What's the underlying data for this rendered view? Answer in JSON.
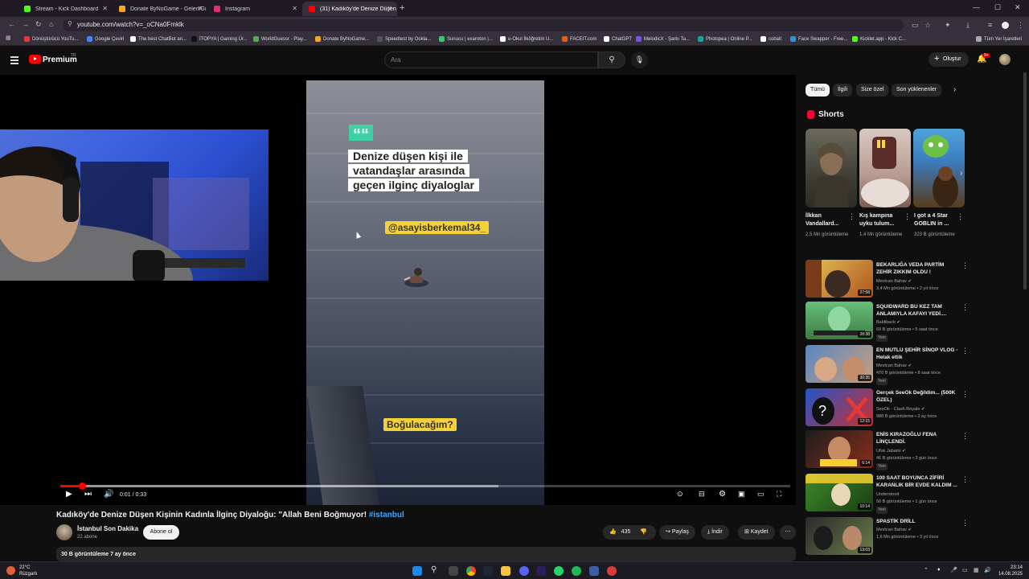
{
  "browser": {
    "tabs": [
      {
        "label": "Stream - Kick Dashboard",
        "color": "#53fc18"
      },
      {
        "label": "Donate ByNoGame - Gelen/Gi",
        "color": "#f5a623"
      },
      {
        "label": "Instagram",
        "color": "#e1306c"
      },
      {
        "label": "(31) Kadıköy'de Denize Düşen",
        "color": "#ff0000"
      }
    ],
    "new_tab": "+",
    "url": "youtube.com/watch?v=_oCNa0Fmklk",
    "bookmarks": [
      {
        "label": "Dönüştürücü YouTu...",
        "color": "#e53935"
      },
      {
        "label": "Google Çeviri",
        "color": "#4285f4"
      },
      {
        "label": "The best ChatBot an...",
        "color": "#ffffff"
      },
      {
        "label": "İTOPYA | Gaming Ür...",
        "color": "#111111"
      },
      {
        "label": "WorldGuessr - Play...",
        "color": "#4caf50"
      },
      {
        "label": "Donate ByNoGame...",
        "color": "#f5a623"
      },
      {
        "label": "Speedtest by Ookla...",
        "color": "#222222"
      },
      {
        "label": "Sunucu | exaroton |...",
        "color": "#3ec46d"
      },
      {
        "label": "e-Okul İlköğretim U...",
        "color": "#ffffff"
      },
      {
        "label": "FACEIT.com",
        "color": "#ff5500"
      },
      {
        "label": "ChatGPT",
        "color": "#ffffff"
      },
      {
        "label": "MelodicX - Şarkı Ta...",
        "color": "#7c4dff"
      },
      {
        "label": "Photopea | Online P...",
        "color": "#18a497"
      },
      {
        "label": "cobalt",
        "color": "#ffffff"
      },
      {
        "label": "Face Swapper - Free...",
        "color": "#2196f3"
      },
      {
        "label": "Kicklet.app - Kick C...",
        "color": "#53fc18"
      }
    ],
    "all_bookmarks": "Tüm Yer İşaretleri"
  },
  "youtube": {
    "logo_text": "Premium",
    "region": "TR",
    "search_placeholder": "Ara",
    "create_label": "Oluştur",
    "notif_count": "9+"
  },
  "video": {
    "overlay": {
      "headline": [
        "Denize düşen kişi ile",
        "vatandaşlar arasında",
        "geçen ilginç diyaloglar"
      ],
      "handle": "@asayisberkemal34_",
      "caption": "Boğulacağım?",
      "quote_mark": "““"
    },
    "time": "0:01 / 0:33",
    "progress": 0.03,
    "buffered": 0.6,
    "title": "Kadıköy'de Denize Düşen Kişinin Kadınla İlginç Diyaloğu: \"Allah Beni Boğmuyor!",
    "hashtag": "#istanbul",
    "channel": "İstanbul Son Dakika",
    "subs": "22 abone",
    "subscribe": "Abone ol",
    "likes": "435",
    "share": "Paylaş",
    "download": "İndir",
    "save": "Kaydet",
    "views_date": "30 B görüntüleme  7 ay önce"
  },
  "sidebar": {
    "chips": [
      "Tümü",
      "İlgili",
      "Size özel",
      "Son yüklenenler"
    ],
    "shorts_title": "Shorts",
    "shorts": [
      {
        "title": "İlkkan Vandallard...",
        "views": "2,5 Mn görüntüleme"
      },
      {
        "title": "Kış kampına uyku tulum...",
        "views": "1,4 Mn görüntüleme"
      },
      {
        "title": "I got a 4 Star GOBLIN in ...",
        "views": "323 B görüntüleme"
      }
    ],
    "recs": [
      {
        "title": "BEKARLIĞA VEDA PARTİM ZEHİR ZIKKIM OLDU !",
        "channel": "Mevtcan Bahav",
        "meta": "3,4 Mn görüntüleme • 2 yıl önce",
        "dur": "27:58",
        "new": ""
      },
      {
        "title": "SQUIDWARD BU KEZ TAM ANLAMIYLA KAFAYI YEDİ....",
        "channel": "Baldiback",
        "meta": "69 B görüntüleme • 5 saat önce",
        "dur": "28:38",
        "new": "Yeni"
      },
      {
        "title": "EN MUTLU ŞEHİR SİNOP VLOG - Helak ettik",
        "channel": "Mevtcan Bahav",
        "meta": "470 B görüntüleme • 8 saat önce",
        "dur": "30:35",
        "new": "Yeni"
      },
      {
        "title": "Gerçek SeeOk Değildim... (500K ÖZEL)",
        "channel": "SeeOk - Clash Royale",
        "meta": "988 B görüntüleme • 2 ay önce",
        "dur": "12:15",
        "new": ""
      },
      {
        "title": "ENİS KIRAZOĞLU FENA LİNÇLENDİ.",
        "channel": "Ufuk Jabami",
        "meta": "46 B görüntüleme • 3 gün önce",
        "dur": "6:14",
        "new": "Yeni"
      },
      {
        "title": "100 SAAT BOYUNCA ZİFİRİ KARANLIK BİR EVDE KALDIM ...",
        "channel": "Understood",
        "meta": "50 B görüntüleme • 1 gün önce",
        "dur": "10:14",
        "new": "Yeni"
      },
      {
        "title": "SPASTİK DRİLL",
        "channel": "Mevtcan Bahav",
        "meta": "1,6 Mn görüntüleme • 3 yıl önce",
        "dur": "13:03",
        "new": ""
      }
    ]
  },
  "taskbar": {
    "temp": "22°C",
    "weather": "Rüzgarlı",
    "time": "23:14",
    "date": "14.08.2025"
  }
}
